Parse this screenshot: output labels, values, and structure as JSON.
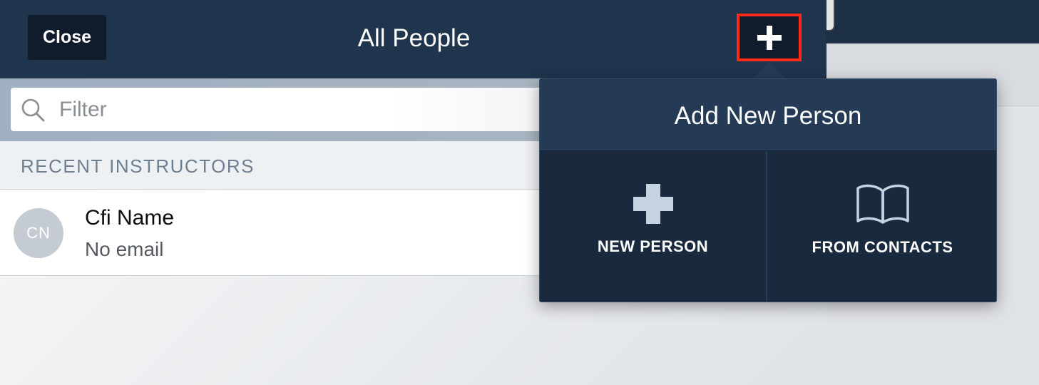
{
  "nav": {
    "close_label": "Close",
    "title": "All People",
    "add_icon": "plus-icon"
  },
  "filter": {
    "placeholder": "Filter",
    "value": "",
    "icon": "search-icon"
  },
  "section": {
    "header": "RECENT INSTRUCTORS"
  },
  "people": [
    {
      "initials": "CN",
      "name": "Cfi Name",
      "email": "No email"
    }
  ],
  "popover": {
    "title": "Add New Person",
    "options": [
      {
        "label": "NEW PERSON",
        "icon": "plus-icon"
      },
      {
        "label": "FROM CONTACTS",
        "icon": "book-icon"
      }
    ]
  },
  "colors": {
    "nav_bg": "#1f344d",
    "button_bg": "#101c2b",
    "highlight": "#ff2a1a",
    "popover_bg": "#1a2a3e",
    "popover_header_bg": "#243a55",
    "section_text": "#6f7f90",
    "avatar_bg": "#c4cbd3",
    "option_icon": "#c5d3e0"
  }
}
